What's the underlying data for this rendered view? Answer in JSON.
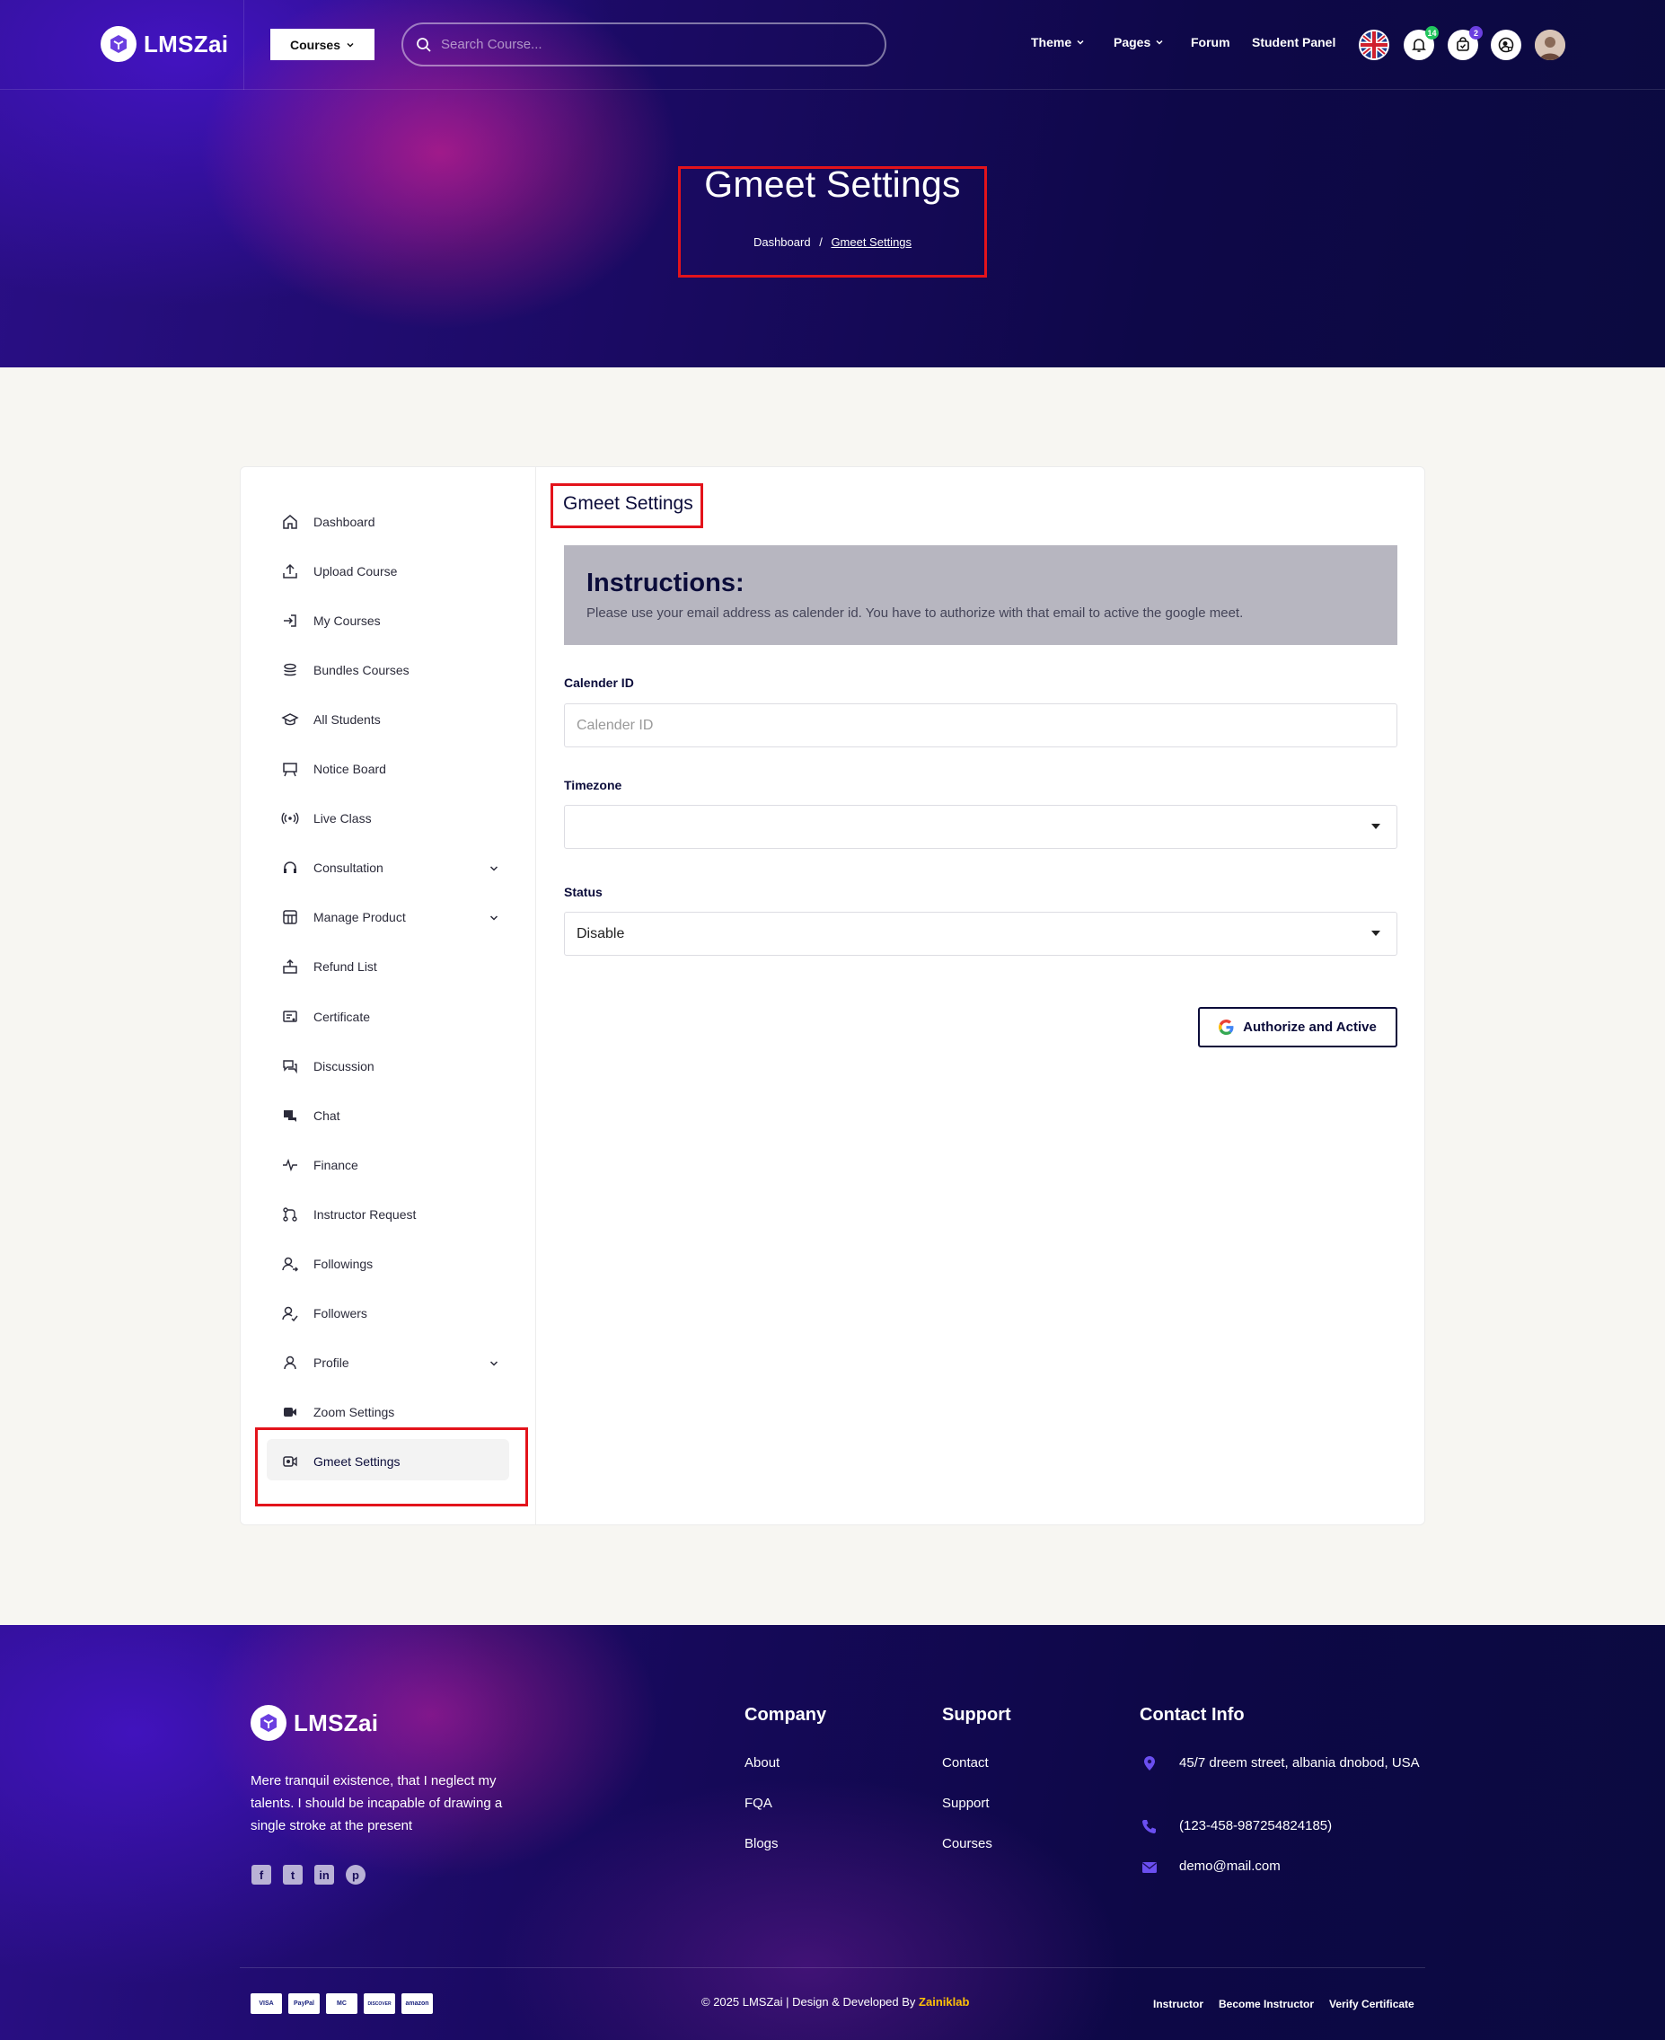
{
  "header": {
    "brand": "LMSZai",
    "courses_label": "Courses",
    "search_placeholder": "Search Course...",
    "nav": [
      "Theme",
      "Pages",
      "Forum",
      "Student Panel"
    ],
    "notifications_count": "14",
    "cart_count": "2"
  },
  "hero": {
    "title": "Gmeet Settings",
    "breadcrumb": [
      "Dashboard",
      "/",
      "Gmeet Settings"
    ]
  },
  "sidebar": {
    "items": [
      {
        "label": "Dashboard",
        "icon": "home-icon"
      },
      {
        "label": "Upload Course",
        "icon": "upload-icon"
      },
      {
        "label": "My Courses",
        "icon": "login-icon"
      },
      {
        "label": "Bundles Courses",
        "icon": "stack-icon"
      },
      {
        "label": "All Students",
        "icon": "graduation-icon"
      },
      {
        "label": "Notice Board",
        "icon": "board-icon"
      },
      {
        "label": "Live Class",
        "icon": "broadcast-icon"
      },
      {
        "label": "Consultation",
        "icon": "headset-icon",
        "expandable": true
      },
      {
        "label": "Manage Product",
        "icon": "store-icon",
        "expandable": true
      },
      {
        "label": "Refund List",
        "icon": "refund-icon"
      },
      {
        "label": "Certificate",
        "icon": "certificate-icon"
      },
      {
        "label": "Discussion",
        "icon": "discussion-icon"
      },
      {
        "label": "Chat",
        "icon": "chat-icon"
      },
      {
        "label": "Finance",
        "icon": "pulse-icon"
      },
      {
        "label": "Instructor Request",
        "icon": "git-icon"
      },
      {
        "label": "Followings",
        "icon": "user-arrow-icon"
      },
      {
        "label": "Followers",
        "icon": "user-check-icon"
      },
      {
        "label": "Profile",
        "icon": "user-icon",
        "expandable": true
      },
      {
        "label": "Zoom Settings",
        "icon": "video-icon"
      },
      {
        "label": "Gmeet Settings",
        "icon": "meet-icon",
        "active": true
      }
    ]
  },
  "main": {
    "title": "Gmeet Settings",
    "instructions_title": "Instructions:",
    "instructions_text": "Please use your email address as calender id. You have to authorize with that email to active the google meet.",
    "calendar_label": "Calender ID",
    "calendar_placeholder": "Calender ID",
    "calendar_value": "",
    "timezone_label": "Timezone",
    "timezone_value": "",
    "status_label": "Status",
    "status_value": "Disable",
    "authorize_label": "Authorize and Active"
  },
  "footer": {
    "brand": "LMSZai",
    "description": "Mere tranquil existence, that I neglect my talents. I should be incapable of drawing a single stroke at the present",
    "company_title": "Company",
    "company_links": [
      "About",
      "FQA",
      "Blogs"
    ],
    "support_title": "Support",
    "support_links": [
      "Contact",
      "Support",
      "Courses"
    ],
    "contact_title": "Contact Info",
    "address": "45/7 dreem street, albania dnobod, USA",
    "phone": "(123-458-987254824185)",
    "email": "demo@mail.com",
    "social": [
      "facebook-icon",
      "twitter-icon",
      "linkedin-icon",
      "pinterest-icon"
    ],
    "payments": [
      "VISA",
      "PayPal",
      "MC",
      "DISCOVER",
      "amazon"
    ],
    "copyright": "© 2025 LMSZai | Design & Developed By",
    "copyright_brand": "Zainiklab",
    "bottom_links": [
      "Instructor",
      "Become Instructor",
      "Verify Certificate"
    ]
  },
  "colors": {
    "accent_dark": "#0b0c3a",
    "highlight_red": "#e3131b",
    "footer_brand": "#ffc107"
  }
}
